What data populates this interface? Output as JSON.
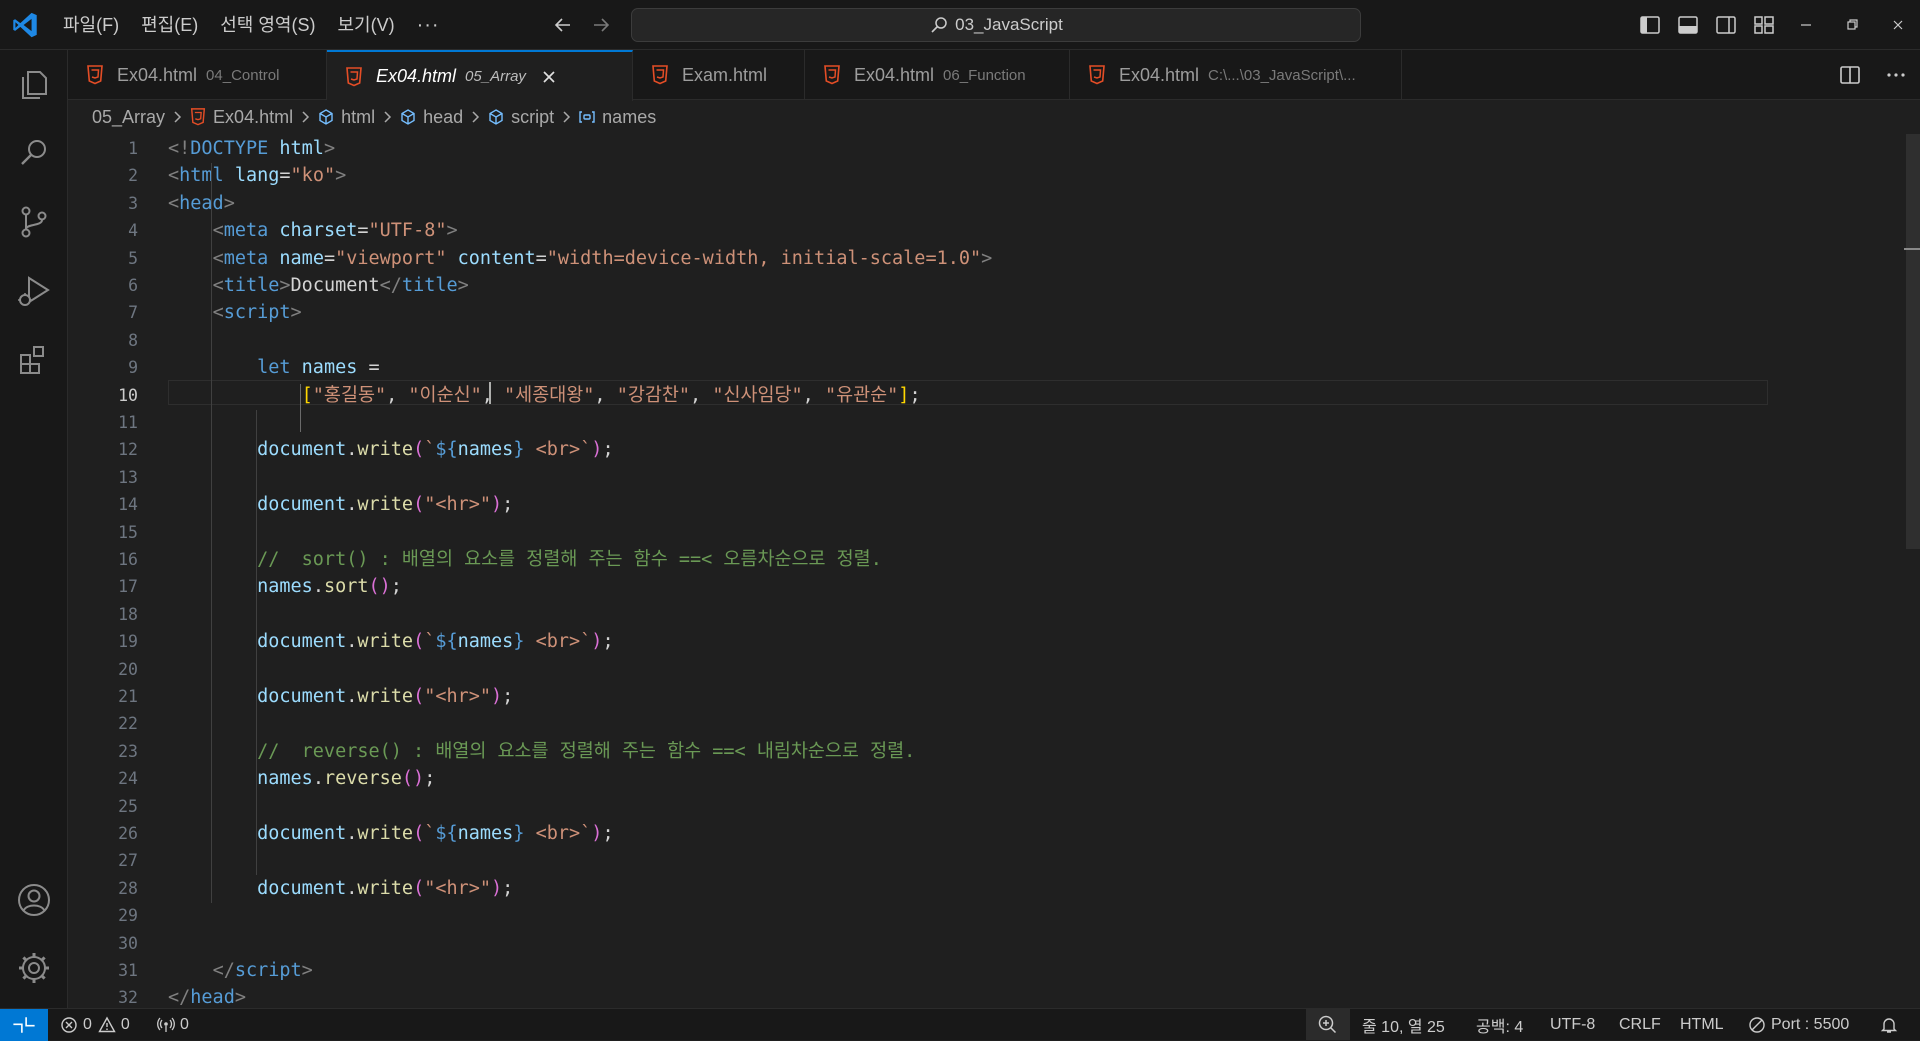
{
  "menu": [
    "파일(F)",
    "편집(E)",
    "선택 영역(S)",
    "보기(V)",
    "···"
  ],
  "search": {
    "text": "03_JavaScript",
    "icon": "search-icon"
  },
  "tabs": [
    {
      "name": "Ex04.html",
      "desc": "04_Control",
      "active": false
    },
    {
      "name": "Ex04.html",
      "desc": "05_Array",
      "active": true
    },
    {
      "name": "Exam.html",
      "desc": "",
      "active": false
    },
    {
      "name": "Ex04.html",
      "desc": "06_Function",
      "active": false
    },
    {
      "name": "Ex04.html",
      "desc": "C:\\...\\03_JavaScript\\...",
      "active": false
    }
  ],
  "breadcrumb": [
    "05_Array",
    "Ex04.html",
    "html",
    "head",
    "script",
    "names"
  ],
  "editor": {
    "current_line": 10,
    "line_numbers": [
      "1",
      "2",
      "3",
      "4",
      "5",
      "6",
      "7",
      "8",
      "9",
      "10",
      "11",
      "12",
      "13",
      "14",
      "15",
      "16",
      "17",
      "18",
      "19",
      "20",
      "21",
      "22",
      "23",
      "24",
      "25",
      "26",
      "27",
      "28",
      "29",
      "30",
      "31",
      "32"
    ],
    "code": [
      [
        [
          "<!",
          "t-punc"
        ],
        [
          "DOCTYPE",
          "t-tag"
        ],
        [
          " html",
          "t-attr"
        ],
        [
          ">",
          "t-punc"
        ]
      ],
      [
        [
          "<",
          "t-punc"
        ],
        [
          "html",
          "t-tag"
        ],
        [
          " lang",
          "t-attr"
        ],
        [
          "=",
          "t-text"
        ],
        [
          "\"ko\"",
          "t-str"
        ],
        [
          ">",
          "t-punc"
        ]
      ],
      [
        [
          "<",
          "t-punc"
        ],
        [
          "head",
          "t-tag"
        ],
        [
          ">",
          "t-punc"
        ]
      ],
      [
        [
          "    ",
          "t-text"
        ],
        [
          "<",
          "t-punc"
        ],
        [
          "meta",
          "t-tag"
        ],
        [
          " charset",
          "t-attr"
        ],
        [
          "=",
          "t-text"
        ],
        [
          "\"UTF-8\"",
          "t-str"
        ],
        [
          ">",
          "t-punc"
        ]
      ],
      [
        [
          "    ",
          "t-text"
        ],
        [
          "<",
          "t-punc"
        ],
        [
          "meta",
          "t-tag"
        ],
        [
          " name",
          "t-attr"
        ],
        [
          "=",
          "t-text"
        ],
        [
          "\"viewport\"",
          "t-str"
        ],
        [
          " content",
          "t-attr"
        ],
        [
          "=",
          "t-text"
        ],
        [
          "\"width=device-width, initial-scale=1.0\"",
          "t-str"
        ],
        [
          ">",
          "t-punc"
        ]
      ],
      [
        [
          "    ",
          "t-text"
        ],
        [
          "<",
          "t-punc"
        ],
        [
          "title",
          "t-tag"
        ],
        [
          ">",
          "t-punc"
        ],
        [
          "Document",
          "t-text"
        ],
        [
          "</",
          "t-punc"
        ],
        [
          "title",
          "t-tag"
        ],
        [
          ">",
          "t-punc"
        ]
      ],
      [
        [
          "    ",
          "t-text"
        ],
        [
          "<",
          "t-punc"
        ],
        [
          "script",
          "t-tag"
        ],
        [
          ">",
          "t-punc"
        ]
      ],
      [
        [
          "",
          "t-text"
        ]
      ],
      [
        [
          "        ",
          "t-text"
        ],
        [
          "let",
          "t-kw"
        ],
        [
          " names",
          "t-var"
        ],
        [
          " =",
          "t-text"
        ]
      ],
      [
        [
          "            ",
          "t-text"
        ],
        [
          "[",
          "t-brk"
        ],
        [
          "\"홍길동\"",
          "t-str"
        ],
        [
          ", ",
          "t-text"
        ],
        [
          "\"이순신\"",
          "t-str"
        ],
        [
          ", ",
          "t-text"
        ],
        [
          "\"세종대왕\"",
          "t-str"
        ],
        [
          ", ",
          "t-text"
        ],
        [
          "\"강감찬\"",
          "t-str"
        ],
        [
          ", ",
          "t-text"
        ],
        [
          "\"신사임당\"",
          "t-str"
        ],
        [
          ", ",
          "t-text"
        ],
        [
          "\"유관순\"",
          "t-str"
        ],
        [
          "]",
          "t-brk"
        ],
        [
          ";",
          "t-text"
        ]
      ],
      [
        [
          "",
          "t-text"
        ]
      ],
      [
        [
          "        ",
          "t-text"
        ],
        [
          "document",
          "t-var"
        ],
        [
          ".",
          "t-text"
        ],
        [
          "write",
          "t-fn"
        ],
        [
          "(",
          "t-brk2"
        ],
        [
          "`",
          "t-str"
        ],
        [
          "${",
          "t-tmpl"
        ],
        [
          "names",
          "t-var"
        ],
        [
          "}",
          "t-tmpl"
        ],
        [
          " <br>`",
          "t-str"
        ],
        [
          ")",
          "t-brk2"
        ],
        [
          ";",
          "t-text"
        ]
      ],
      [
        [
          "",
          "t-text"
        ]
      ],
      [
        [
          "        ",
          "t-text"
        ],
        [
          "document",
          "t-var"
        ],
        [
          ".",
          "t-text"
        ],
        [
          "write",
          "t-fn"
        ],
        [
          "(",
          "t-brk2"
        ],
        [
          "\"<hr>\"",
          "t-str"
        ],
        [
          ")",
          "t-brk2"
        ],
        [
          ";",
          "t-text"
        ]
      ],
      [
        [
          "",
          "t-text"
        ]
      ],
      [
        [
          "        ",
          "t-text"
        ],
        [
          "//  sort() : 배열의 요소를 정렬해 주는 함수 ==< 오름차순으로 정렬.",
          "t-cmt"
        ]
      ],
      [
        [
          "        ",
          "t-text"
        ],
        [
          "names",
          "t-var"
        ],
        [
          ".",
          "t-text"
        ],
        [
          "sort",
          "t-fn"
        ],
        [
          "()",
          "t-brk2"
        ],
        [
          ";",
          "t-text"
        ]
      ],
      [
        [
          "",
          "t-text"
        ]
      ],
      [
        [
          "        ",
          "t-text"
        ],
        [
          "document",
          "t-var"
        ],
        [
          ".",
          "t-text"
        ],
        [
          "write",
          "t-fn"
        ],
        [
          "(",
          "t-brk2"
        ],
        [
          "`",
          "t-str"
        ],
        [
          "${",
          "t-tmpl"
        ],
        [
          "names",
          "t-var"
        ],
        [
          "}",
          "t-tmpl"
        ],
        [
          " <br>`",
          "t-str"
        ],
        [
          ")",
          "t-brk2"
        ],
        [
          ";",
          "t-text"
        ]
      ],
      [
        [
          "",
          "t-text"
        ]
      ],
      [
        [
          "        ",
          "t-text"
        ],
        [
          "document",
          "t-var"
        ],
        [
          ".",
          "t-text"
        ],
        [
          "write",
          "t-fn"
        ],
        [
          "(",
          "t-brk2"
        ],
        [
          "\"<hr>\"",
          "t-str"
        ],
        [
          ")",
          "t-brk2"
        ],
        [
          ";",
          "t-text"
        ]
      ],
      [
        [
          "",
          "t-text"
        ]
      ],
      [
        [
          "        ",
          "t-text"
        ],
        [
          "//  reverse() : 배열의 요소를 정렬해 주는 함수 ==< 내림차순으로 정렬.",
          "t-cmt"
        ]
      ],
      [
        [
          "        ",
          "t-text"
        ],
        [
          "names",
          "t-var"
        ],
        [
          ".",
          "t-text"
        ],
        [
          "reverse",
          "t-fn"
        ],
        [
          "()",
          "t-brk2"
        ],
        [
          ";",
          "t-text"
        ]
      ],
      [
        [
          "",
          "t-text"
        ]
      ],
      [
        [
          "        ",
          "t-text"
        ],
        [
          "document",
          "t-var"
        ],
        [
          ".",
          "t-text"
        ],
        [
          "write",
          "t-fn"
        ],
        [
          "(",
          "t-brk2"
        ],
        [
          "`",
          "t-str"
        ],
        [
          "${",
          "t-tmpl"
        ],
        [
          "names",
          "t-var"
        ],
        [
          "}",
          "t-tmpl"
        ],
        [
          " <br>`",
          "t-str"
        ],
        [
          ")",
          "t-brk2"
        ],
        [
          ";",
          "t-text"
        ]
      ],
      [
        [
          "",
          "t-text"
        ]
      ],
      [
        [
          "        ",
          "t-text"
        ],
        [
          "document",
          "t-var"
        ],
        [
          ".",
          "t-text"
        ],
        [
          "write",
          "t-fn"
        ],
        [
          "(",
          "t-brk2"
        ],
        [
          "\"<hr>\"",
          "t-str"
        ],
        [
          ")",
          "t-brk2"
        ],
        [
          ";",
          "t-text"
        ]
      ],
      [
        [
          "",
          "t-text"
        ]
      ],
      [
        [
          "",
          "t-text"
        ]
      ],
      [
        [
          "    ",
          "t-text"
        ],
        [
          "</",
          "t-punc"
        ],
        [
          "script",
          "t-tag"
        ],
        [
          ">",
          "t-punc"
        ]
      ],
      [
        [
          "</",
          "t-punc"
        ],
        [
          "head",
          "t-tag"
        ],
        [
          ">",
          "t-punc"
        ]
      ]
    ]
  },
  "status": {
    "errors": "0",
    "warnings": "0",
    "ports": "0",
    "position": "줄 10, 열 25",
    "spaces": "공백: 4",
    "encoding": "UTF-8",
    "eol": "CRLF",
    "language": "HTML",
    "port": "Port : 5500"
  },
  "colors": {
    "accent": "#0078d4",
    "html_icon": "#e44d26"
  }
}
